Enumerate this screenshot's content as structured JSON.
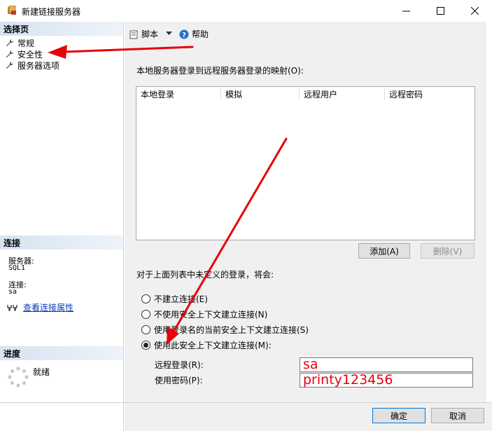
{
  "window": {
    "title": "新建链接服务器",
    "minimize_glyph": "—",
    "maximize_glyph": "☐",
    "close_glyph": "✕"
  },
  "left_pane": {
    "select_page_header": "选择页",
    "pages": [
      {
        "label": "常规",
        "icon": "wrench-icon"
      },
      {
        "label": "安全性",
        "icon": "wrench-icon"
      },
      {
        "label": "服务器选项",
        "icon": "wrench-icon"
      }
    ],
    "connection_header": "连接",
    "server_label": "服务器:",
    "server_value": "SQL1",
    "connection_label": "连接:",
    "connection_value": "sa",
    "view_connection_link": "查看连接属性",
    "progress_header": "进度",
    "progress_status": "就绪"
  },
  "toolbar": {
    "script_label": "脚本",
    "help_label": "帮助"
  },
  "security": {
    "mapping_label": "本地服务器登录到远程服务器登录的映射(O):",
    "columns": [
      "本地登录",
      "模拟",
      "远程用户",
      "远程密码"
    ],
    "add_button": "添加(A)",
    "remove_button": "删除(V)",
    "note": "对于上面列表中未定义的登录，将会:",
    "options": [
      {
        "label": "不建立连接(E)",
        "checked": false
      },
      {
        "label": "不使用安全上下文建立连接(N)",
        "checked": false
      },
      {
        "label": "使用登录名的当前安全上下文建立连接(S)",
        "checked": false
      },
      {
        "label": "使用此安全上下文建立连接(M):",
        "checked": true
      }
    ],
    "remote_login_label": "远程登录(R):",
    "remote_login_value": "sa",
    "password_label": "使用密码(P):",
    "password_value": "printy123456"
  },
  "footer": {
    "ok_button": "确定",
    "cancel_button": "取消"
  },
  "colors": {
    "annotation_red": "#e8000b",
    "link_blue": "#0b3db8",
    "section_header": "#d7e3f2"
  }
}
